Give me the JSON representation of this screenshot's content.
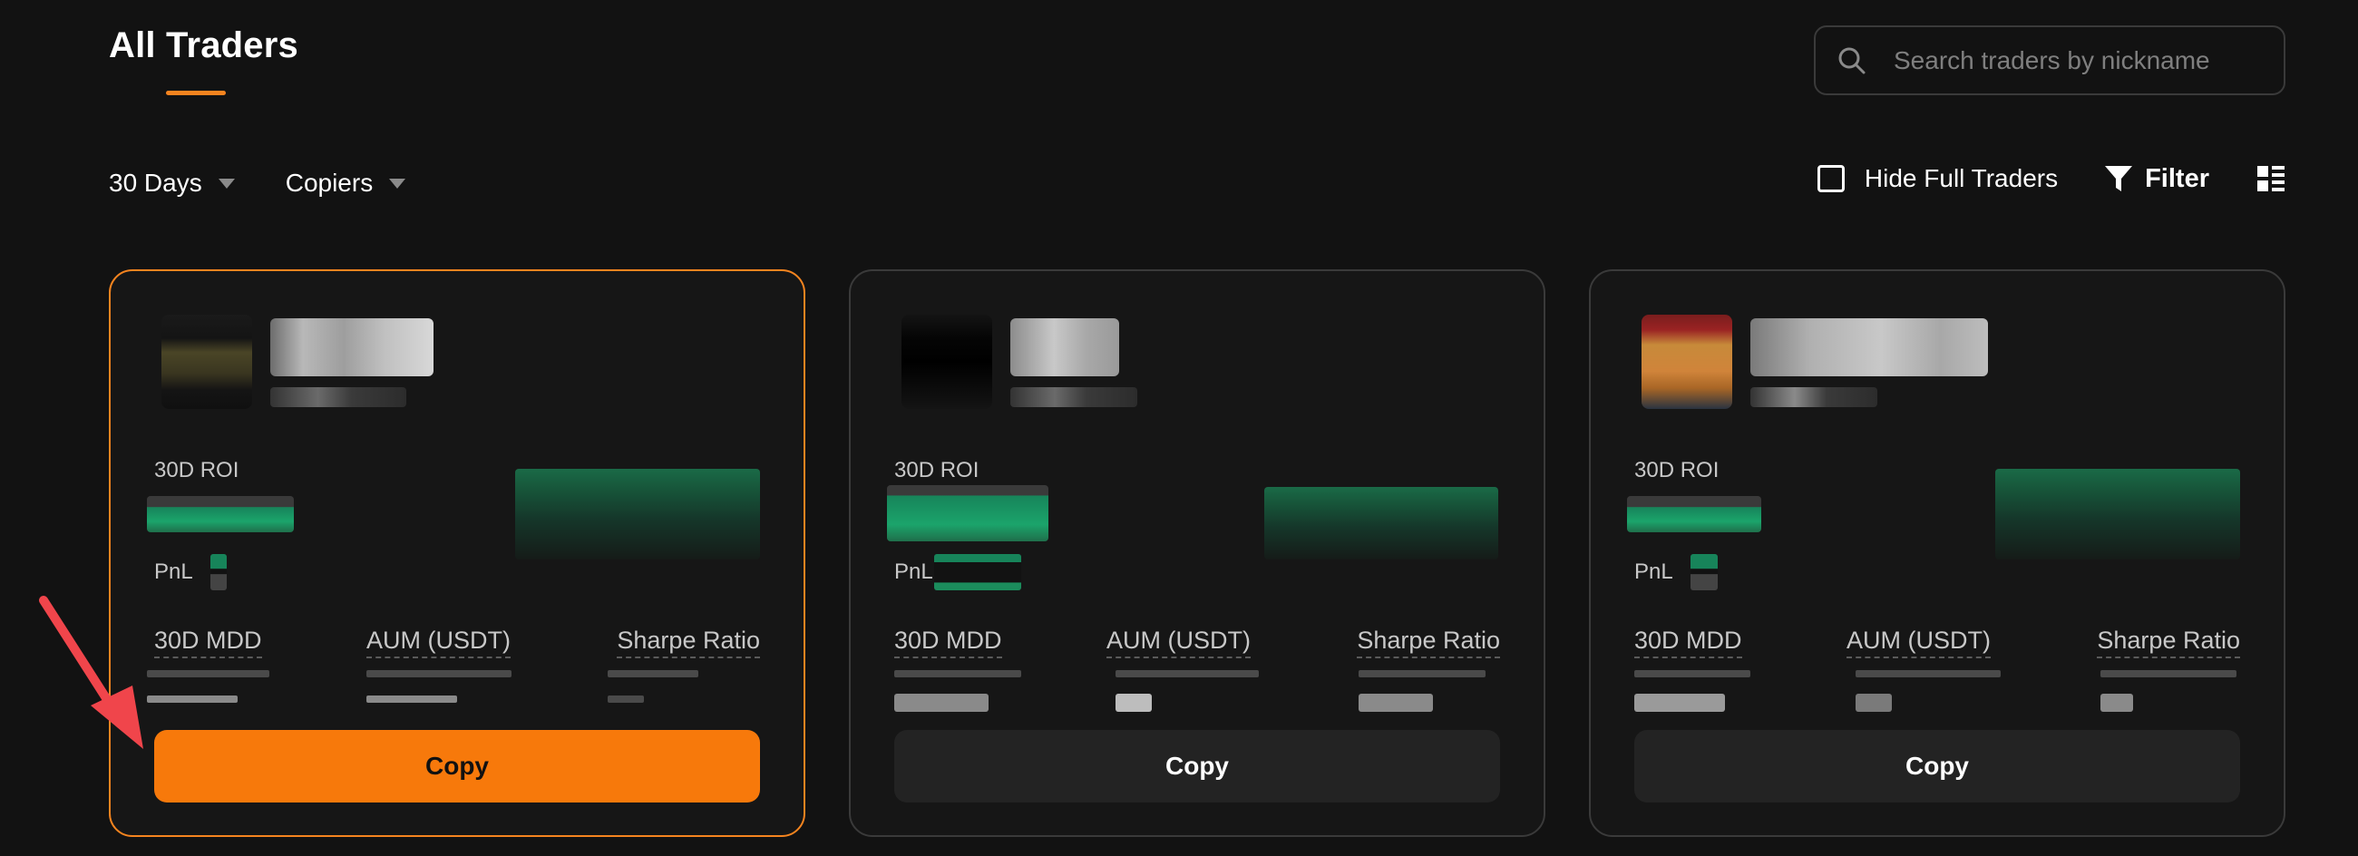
{
  "page": {
    "title": "All Traders"
  },
  "search": {
    "placeholder": "Search traders by nickname",
    "icon": "search-icon"
  },
  "filters": {
    "period": "30 Days",
    "sort": "Copiers",
    "hide_full_label": "Hide Full Traders",
    "hide_full_checked": false,
    "filter_label": "Filter"
  },
  "colors": {
    "accent": "#f7790b",
    "background": "#121212",
    "card": "#161616",
    "positive": "#1a9a63"
  },
  "cards": [
    {
      "selected": true,
      "roi_label": "30D ROI",
      "pnl_label": "PnL",
      "mdd_label": "30D MDD",
      "aum_label": "AUM (USDT)",
      "sharpe_label": "Sharpe Ratio",
      "copy_label": "Copy"
    },
    {
      "selected": false,
      "roi_label": "30D ROI",
      "pnl_label": "PnL",
      "mdd_label": "30D MDD",
      "aum_label": "AUM (USDT)",
      "sharpe_label": "Sharpe Ratio",
      "copy_label": "Copy"
    },
    {
      "selected": false,
      "roi_label": "30D ROI",
      "pnl_label": "PnL",
      "mdd_label": "30D MDD",
      "aum_label": "AUM (USDT)",
      "sharpe_label": "Sharpe Ratio",
      "copy_label": "Copy"
    }
  ]
}
